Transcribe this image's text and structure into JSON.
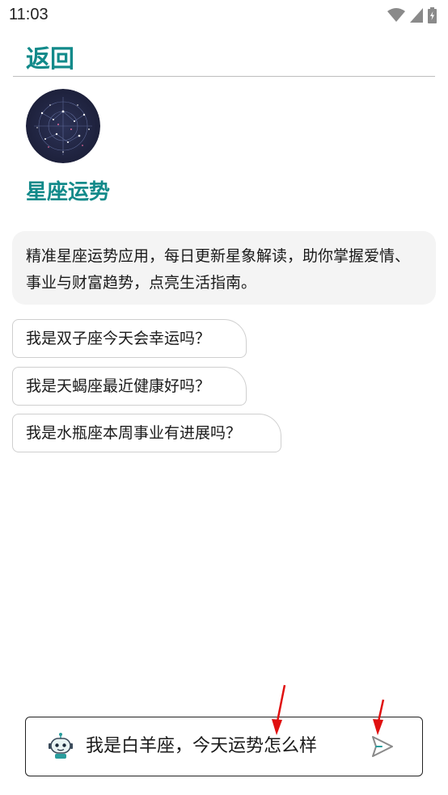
{
  "status_bar": {
    "time": "11:03",
    "icons": [
      "wifi-icon",
      "signal-icon",
      "battery-charging-icon"
    ]
  },
  "header": {
    "back_label": "返回"
  },
  "app": {
    "title": "星座运势",
    "avatar": "starry-sky-avatar",
    "description": "精准星座运势应用，每日更新星象解读，助你掌握爱情、事业与财富趋势，点亮生活指南。"
  },
  "suggestions": [
    {
      "label": "我是双子座今天会幸运吗？"
    },
    {
      "label": "我是天蝎座最近健康好吗？"
    },
    {
      "label": "我是水瓶座本周事业有进展吗？"
    }
  ],
  "input": {
    "value": "我是白羊座，今天运势怎么样",
    "assistant_icon": "robot-icon",
    "send_icon": "send-icon"
  },
  "colors": {
    "accent": "#128a8a",
    "bubble_bg": "#f4f4f4",
    "annotation_arrow": "#e01010"
  }
}
